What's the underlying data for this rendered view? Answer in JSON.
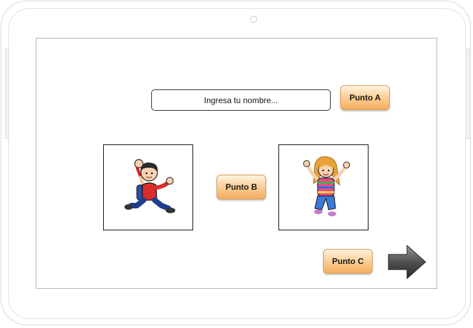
{
  "form": {
    "name_placeholder": "Ingresa tu nombre...",
    "name_value": ""
  },
  "buttons": {
    "punto_a": "Punto A",
    "punto_b": "Punto B",
    "punto_c": "Punto C"
  },
  "images": {
    "boy": "boy-character",
    "girl": "girl-character"
  },
  "navigation": {
    "next_icon": "arrow-right-icon"
  },
  "colors": {
    "button_light": "#fff3e2",
    "button_dark": "#f5ae5e",
    "arrow": "#555555"
  }
}
